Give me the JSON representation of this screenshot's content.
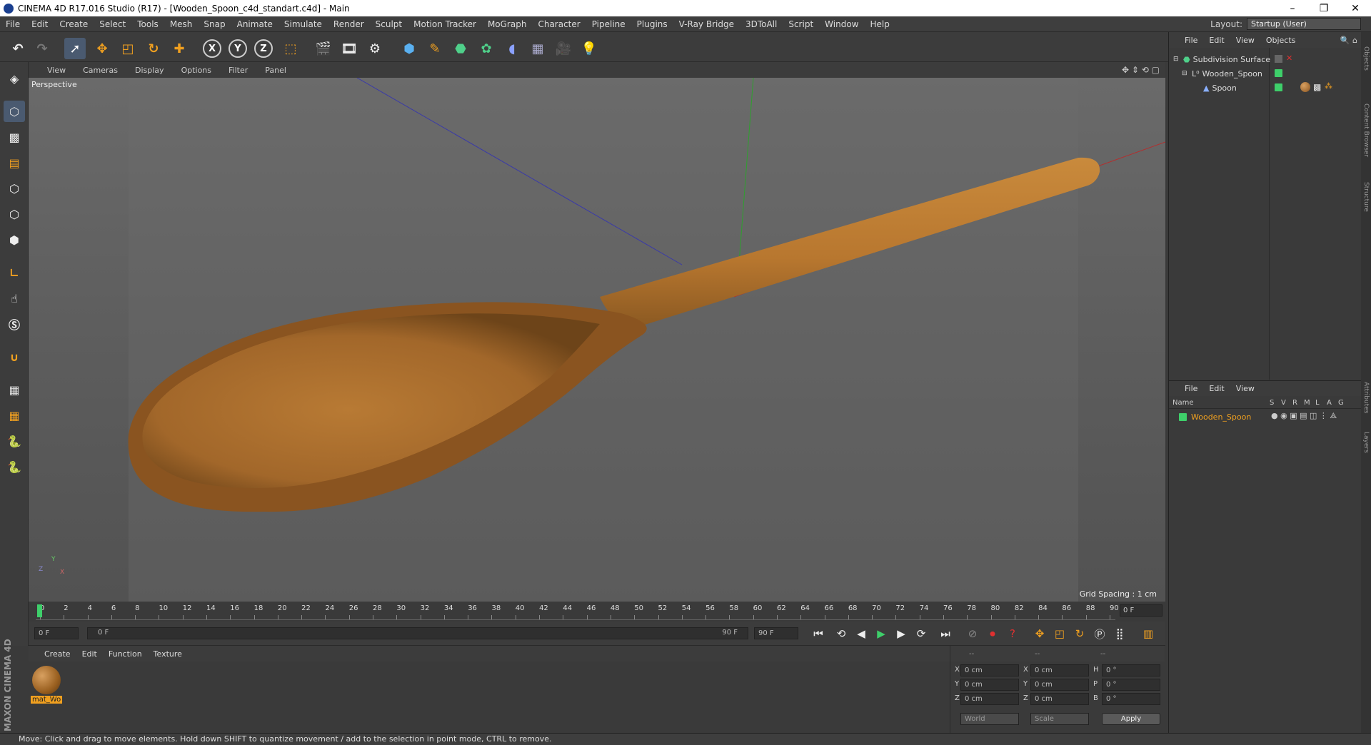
{
  "window": {
    "title": "CINEMA 4D R17.016 Studio (R17) - [Wooden_Spoon_c4d_standart.c4d] - Main",
    "controls": {
      "minimize": "–",
      "restore": "❐",
      "close": "✕"
    }
  },
  "menu": [
    "File",
    "Edit",
    "Create",
    "Select",
    "Tools",
    "Mesh",
    "Snap",
    "Animate",
    "Simulate",
    "Render",
    "Sculpt",
    "Motion Tracker",
    "MoGraph",
    "Character",
    "Pipeline",
    "Plugins",
    "V-Ray Bridge",
    "3DToAll",
    "Script",
    "Window",
    "Help"
  ],
  "layout": {
    "label": "Layout:",
    "value": "Startup (User)"
  },
  "toolbar": {
    "icons": [
      "undo-icon",
      "redo-icon",
      "select-arrow-icon",
      "move-icon",
      "scale-icon",
      "rotate-icon",
      "add-icon",
      "x-axis-icon",
      "y-axis-icon",
      "z-axis-icon",
      "coord-system-icon",
      "render-view-icon",
      "render-picture-icon",
      "render-settings-icon",
      "cube-icon",
      "pen-icon",
      "subdivision-icon",
      "cloner-icon",
      "deformer-icon",
      "floor-icon",
      "camera-icon",
      "light-icon"
    ],
    "axis_labels": [
      "X",
      "Y",
      "Z"
    ]
  },
  "viewport": {
    "menu": [
      "View",
      "Cameras",
      "Display",
      "Options",
      "Filter",
      "Panel"
    ],
    "label": "Perspective",
    "grid_spacing": "Grid Spacing : 1 cm",
    "axis_gizmo": {
      "x": "X",
      "y": "Y",
      "z": "Z"
    }
  },
  "timeline": {
    "ticks": [
      "0",
      "2",
      "4",
      "6",
      "8",
      "10",
      "12",
      "14",
      "16",
      "18",
      "20",
      "22",
      "24",
      "26",
      "28",
      "30",
      "32",
      "34",
      "36",
      "38",
      "40",
      "42",
      "44",
      "46",
      "48",
      "50",
      "52",
      "54",
      "56",
      "58",
      "60",
      "62",
      "64",
      "66",
      "68",
      "70",
      "72",
      "74",
      "76",
      "78",
      "80",
      "82",
      "84",
      "86",
      "88",
      "90"
    ],
    "end_field": "0 F"
  },
  "transport": {
    "current": "0 F",
    "range_start": "0 F",
    "range_end": "90 F",
    "max": "90 F"
  },
  "materials": {
    "menu": [
      "Create",
      "Edit",
      "Function",
      "Texture"
    ],
    "items": [
      {
        "name": "mat_Wo"
      }
    ]
  },
  "coordinates": {
    "headers": [
      "--",
      "--",
      "--"
    ],
    "rows": [
      {
        "a": "X",
        "av": "0 cm",
        "b": "X",
        "bv": "0 cm",
        "c": "H",
        "cv": "0 °"
      },
      {
        "a": "Y",
        "av": "0 cm",
        "b": "Y",
        "bv": "0 cm",
        "c": "P",
        "cv": "0 °"
      },
      {
        "a": "Z",
        "av": "0 cm",
        "b": "Z",
        "bv": "0 cm",
        "c": "B",
        "cv": "0 °"
      }
    ],
    "mode": "World",
    "transform": "Scale",
    "apply": "Apply"
  },
  "objects": {
    "menu": [
      "File",
      "Edit",
      "View",
      "Objects"
    ],
    "tree": [
      {
        "name": "Subdivision Surface",
        "indent": 0
      },
      {
        "name": "Wooden_Spoon",
        "indent": 1
      },
      {
        "name": "Spoon",
        "indent": 2
      }
    ]
  },
  "layers": {
    "menu": [
      "File",
      "Edit",
      "View"
    ],
    "columns": [
      "Name",
      "S",
      "V",
      "R",
      "M",
      "L",
      "A",
      "G"
    ],
    "rows": [
      {
        "name": "Wooden_Spoon"
      }
    ]
  },
  "side_tabs": [
    "Objects",
    "Content Browser",
    "Structure",
    "Attributes",
    "Layers"
  ],
  "brand": "MAXON CINEMA 4D",
  "status": "Move: Click and drag to move elements. Hold down SHIFT to quantize movement / add to the selection in point mode, CTRL to remove.",
  "colors": {
    "accent": "#f0a020",
    "spoon": "#b8772f",
    "active_tag": "#3ecf6a"
  }
}
